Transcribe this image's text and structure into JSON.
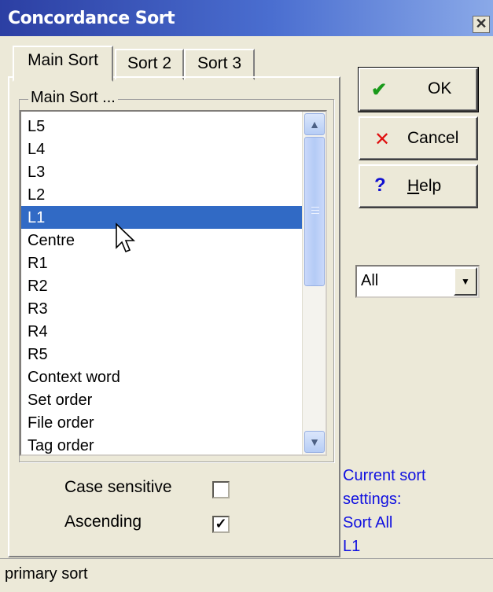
{
  "window": {
    "title": "Concordance Sort",
    "close_symbol": "✕"
  },
  "tabs": [
    {
      "label": "Main Sort",
      "active": true
    },
    {
      "label": "Sort 2",
      "active": false
    },
    {
      "label": "Sort 3",
      "active": false
    }
  ],
  "groupbox": {
    "label": "Main Sort ..."
  },
  "list": {
    "items": [
      "L5",
      "L4",
      "L3",
      "L2",
      "L1",
      "Centre",
      "R1",
      "R2",
      "R3",
      "R4",
      "R5",
      "Context word",
      "Set order",
      "File order",
      "Tag order"
    ],
    "selected": "L1"
  },
  "buttons": {
    "ok": {
      "glyph": "✔",
      "label": "OK"
    },
    "cancel": {
      "glyph": "✕",
      "label": "Cancel"
    },
    "help": {
      "glyph": "?",
      "label_underlined": "H",
      "label_rest": "elp"
    }
  },
  "dropdown": {
    "value": "All"
  },
  "options": {
    "case_sensitive": {
      "label": "Case sensitive",
      "checked": false
    },
    "ascending": {
      "label": "Ascending",
      "checked": true,
      "check_mark": "✓"
    }
  },
  "current_sort": {
    "line1": "Current sort",
    "line2": "settings:",
    "line3": "Sort All",
    "line4": "L1"
  },
  "status": {
    "text": "primary sort"
  },
  "colors": {
    "selection": "#316ac5",
    "info_text": "#1010e0",
    "ok_check": "#1a9a1a",
    "cancel_x": "#e01010",
    "help_q": "#1010d0"
  }
}
